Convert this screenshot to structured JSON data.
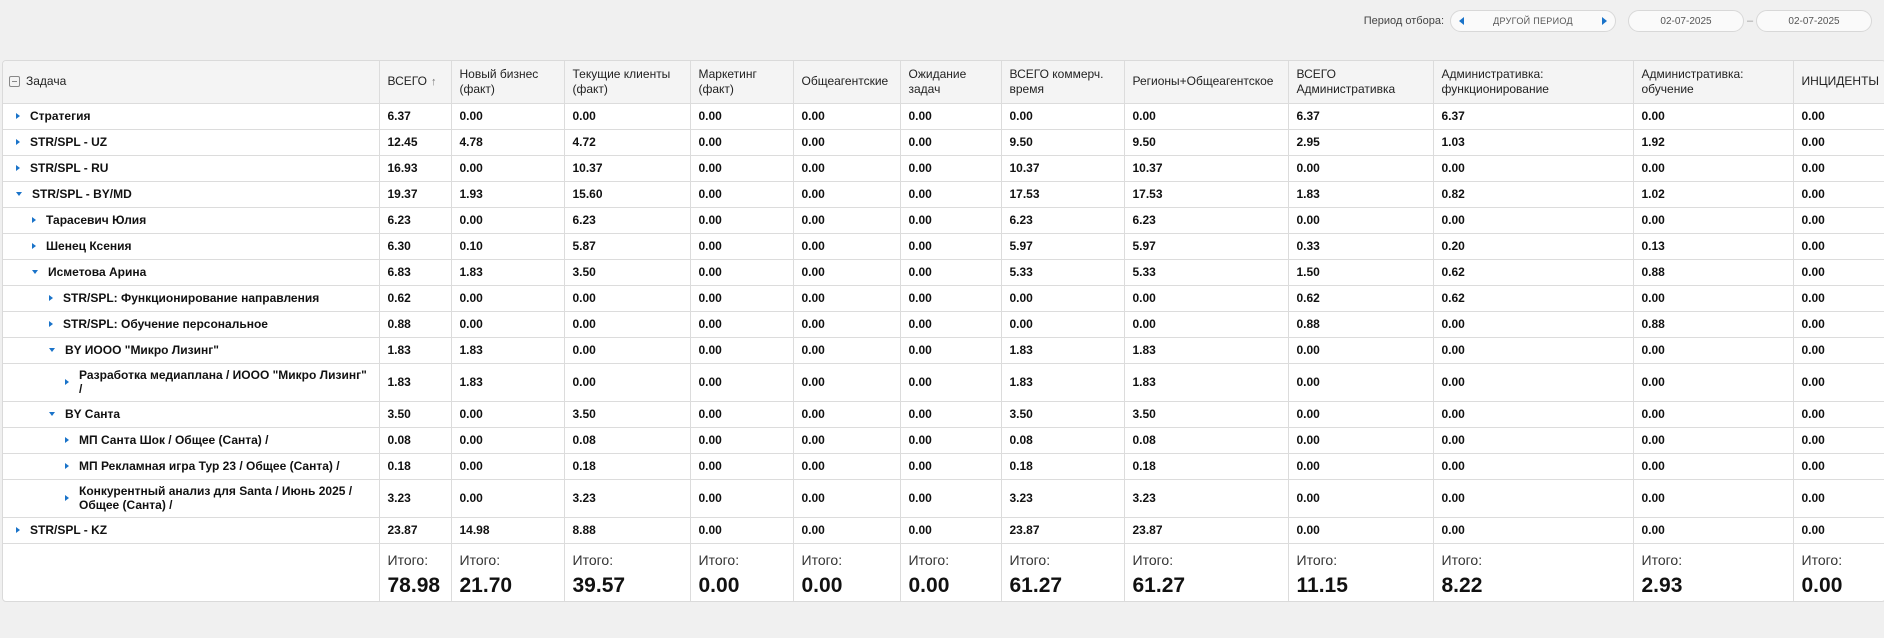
{
  "period": {
    "label": "Период отбора:",
    "selector_text": "ДРУГОЙ ПЕРИОД",
    "date_from": "02-07-2025",
    "date_to": "02-07-2025",
    "separator": "–"
  },
  "table": {
    "headers": [
      "Задача",
      "ВСЕГО",
      "Новый бизнес (факт)",
      "Текущие клиенты (факт)",
      "Маркетинг (факт)",
      "Общеагентские",
      "Ожидание задач",
      "ВСЕГО коммерч. время",
      "Регионы+Общеагентское",
      "ВСЕГО Административка",
      "Административка: функционирование",
      "Административка: обучение",
      "ИНЦИДЕНТЫ"
    ],
    "sort_indicator": "↑",
    "rows": [
      {
        "name": "Стратегия",
        "level": 0,
        "expanded": false,
        "values": [
          "6.37",
          "0.00",
          "0.00",
          "0.00",
          "0.00",
          "0.00",
          "0.00",
          "0.00",
          "6.37",
          "6.37",
          "0.00",
          "0.00"
        ]
      },
      {
        "name": "STR/SPL - UZ",
        "level": 0,
        "expanded": false,
        "values": [
          "12.45",
          "4.78",
          "4.72",
          "0.00",
          "0.00",
          "0.00",
          "9.50",
          "9.50",
          "2.95",
          "1.03",
          "1.92",
          "0.00"
        ]
      },
      {
        "name": "STR/SPL - RU",
        "level": 0,
        "expanded": false,
        "values": [
          "16.93",
          "0.00",
          "10.37",
          "0.00",
          "0.00",
          "0.00",
          "10.37",
          "10.37",
          "0.00",
          "0.00",
          "0.00",
          "0.00"
        ]
      },
      {
        "name": "STR/SPL - BY/MD",
        "level": 0,
        "expanded": true,
        "values": [
          "19.37",
          "1.93",
          "15.60",
          "0.00",
          "0.00",
          "0.00",
          "17.53",
          "17.53",
          "1.83",
          "0.82",
          "1.02",
          "0.00"
        ]
      },
      {
        "name": "Тарасевич Юлия",
        "level": 1,
        "expanded": false,
        "values": [
          "6.23",
          "0.00",
          "6.23",
          "0.00",
          "0.00",
          "0.00",
          "6.23",
          "6.23",
          "0.00",
          "0.00",
          "0.00",
          "0.00"
        ]
      },
      {
        "name": "Шенец Ксения",
        "level": 1,
        "expanded": false,
        "values": [
          "6.30",
          "0.10",
          "5.87",
          "0.00",
          "0.00",
          "0.00",
          "5.97",
          "5.97",
          "0.33",
          "0.20",
          "0.13",
          "0.00"
        ]
      },
      {
        "name": "Исметова Арина",
        "level": 1,
        "expanded": true,
        "values": [
          "6.83",
          "1.83",
          "3.50",
          "0.00",
          "0.00",
          "0.00",
          "5.33",
          "5.33",
          "1.50",
          "0.62",
          "0.88",
          "0.00"
        ]
      },
      {
        "name": "STR/SPL: Функционирование направления",
        "level": 2,
        "expanded": false,
        "values": [
          "0.62",
          "0.00",
          "0.00",
          "0.00",
          "0.00",
          "0.00",
          "0.00",
          "0.00",
          "0.62",
          "0.62",
          "0.00",
          "0.00"
        ]
      },
      {
        "name": "STR/SPL: Обучение персональное",
        "level": 2,
        "expanded": false,
        "values": [
          "0.88",
          "0.00",
          "0.00",
          "0.00",
          "0.00",
          "0.00",
          "0.00",
          "0.00",
          "0.88",
          "0.00",
          "0.88",
          "0.00"
        ]
      },
      {
        "name": "BY ИООО \"Микро Лизинг\"",
        "level": 2,
        "expanded": true,
        "values": [
          "1.83",
          "1.83",
          "0.00",
          "0.00",
          "0.00",
          "0.00",
          "1.83",
          "1.83",
          "0.00",
          "0.00",
          "0.00",
          "0.00"
        ]
      },
      {
        "name": "Разработка медиаплана / ИООО \"Микро Лизинг\" /",
        "level": 3,
        "expanded": false,
        "tall": true,
        "values": [
          "1.83",
          "1.83",
          "0.00",
          "0.00",
          "0.00",
          "0.00",
          "1.83",
          "1.83",
          "0.00",
          "0.00",
          "0.00",
          "0.00"
        ]
      },
      {
        "name": "BY Санта",
        "level": 2,
        "expanded": true,
        "values": [
          "3.50",
          "0.00",
          "3.50",
          "0.00",
          "0.00",
          "0.00",
          "3.50",
          "3.50",
          "0.00",
          "0.00",
          "0.00",
          "0.00"
        ]
      },
      {
        "name": "МП Санта Шок / Общее (Санта) /",
        "level": 3,
        "expanded": false,
        "values": [
          "0.08",
          "0.00",
          "0.08",
          "0.00",
          "0.00",
          "0.00",
          "0.08",
          "0.08",
          "0.00",
          "0.00",
          "0.00",
          "0.00"
        ]
      },
      {
        "name": "МП Рекламная игра Тур 23 / Общее (Санта) /",
        "level": 3,
        "expanded": false,
        "values": [
          "0.18",
          "0.00",
          "0.18",
          "0.00",
          "0.00",
          "0.00",
          "0.18",
          "0.18",
          "0.00",
          "0.00",
          "0.00",
          "0.00"
        ]
      },
      {
        "name": "Конкурентный анализ для Santa / Июнь 2025 / Общее (Санта) /",
        "level": 3,
        "expanded": false,
        "tall": true,
        "values": [
          "3.23",
          "0.00",
          "3.23",
          "0.00",
          "0.00",
          "0.00",
          "3.23",
          "3.23",
          "0.00",
          "0.00",
          "0.00",
          "0.00"
        ]
      },
      {
        "name": "STR/SPL - KZ",
        "level": 0,
        "expanded": false,
        "values": [
          "23.87",
          "14.98",
          "8.88",
          "0.00",
          "0.00",
          "0.00",
          "23.87",
          "23.87",
          "0.00",
          "0.00",
          "0.00",
          "0.00"
        ]
      }
    ],
    "totals_label": "Итого:",
    "totals": [
      "78.98",
      "21.70",
      "39.57",
      "0.00",
      "0.00",
      "0.00",
      "61.27",
      "61.27",
      "11.15",
      "8.22",
      "2.93",
      "0.00"
    ]
  }
}
